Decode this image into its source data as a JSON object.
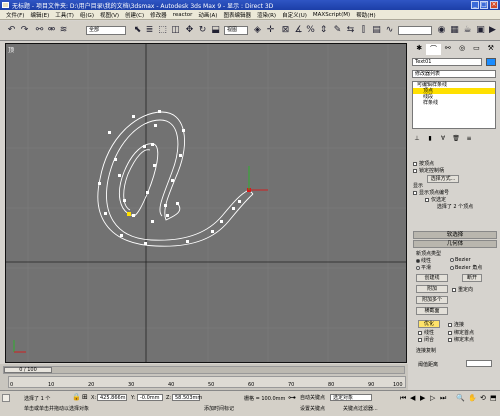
{
  "window": {
    "title": "无标题  - 项目文件夹: D:\\用户目录\\我的文档\\3dsmax  - Autodesk 3ds Max 9  - 显示 : Direct 3D",
    "min": "_",
    "max": "□",
    "close": "×"
  },
  "menu": [
    "文件(F)",
    "编辑(E)",
    "工具(T)",
    "组(G)",
    "视图(V)",
    "创建(C)",
    "修改器",
    "reactor",
    "动画(A)",
    "图表编辑器",
    "渲染(R)",
    "自定义(U)",
    "MAXScript(M)",
    "帮助(H)"
  ],
  "toolbar": {
    "select_filter": "全部",
    "view": "视图"
  },
  "viewport": {
    "label": "顶"
  },
  "panel": {
    "object_name": "Text01",
    "modifier_list": "修改器列表",
    "stack": [
      {
        "label": "可编辑样条线",
        "active": false
      },
      {
        "label": "顶点",
        "active": true
      },
      {
        "label": "线段",
        "active": false
      },
      {
        "label": "样条线",
        "active": false
      }
    ],
    "sel": {
      "by_vertex": "按顶点",
      "lock_handles": "锁定控制柄",
      "sel_method": "选择方式...",
      "show": "显示",
      "show_vertex_numbers": "显示顶点编号",
      "only_selected": "仅选定",
      "status": "选择了 2 个顶点"
    },
    "soft_selection": "软选择",
    "geometry": "几何体",
    "new_vertex_type": "新顶点类型",
    "vertex_types": [
      "线性",
      "Bezier",
      "平滑",
      "Bezier 角点"
    ],
    "create_line": "创建线",
    "break": "断开",
    "attach": "附加",
    "reorient": "重定向",
    "attach_multiple": "附加多个",
    "cross_section": "横截面",
    "refine": "优化",
    "connect": "连接",
    "linear": "线性",
    "bind_first": "绑定首点",
    "closed": "闭合",
    "bind_last": "绑定末点",
    "connect_copy": "连接复制",
    "threshold_distance": "阈值距离"
  },
  "timeline": {
    "frame": "0 / 100",
    "ticks": [
      "0",
      "10",
      "20",
      "30",
      "40",
      "50",
      "60",
      "70",
      "80",
      "90",
      "100"
    ]
  },
  "status": {
    "selected": "选择了 1 个",
    "x_label": "X:",
    "x": "425.866m",
    "y_label": "Y:",
    "y": "-0.0mm",
    "z_label": "Z:",
    "z": "58.503mm",
    "grid": "栅格 = 100.0mm",
    "prompt": "单击或单击并拖动以选择对象",
    "add_time_tag": "添加时间标记",
    "auto_key": "自动关键点",
    "selected_obj": "选定对象",
    "set_key": "设置关键点",
    "key_filters": "关键点过滤器..."
  }
}
